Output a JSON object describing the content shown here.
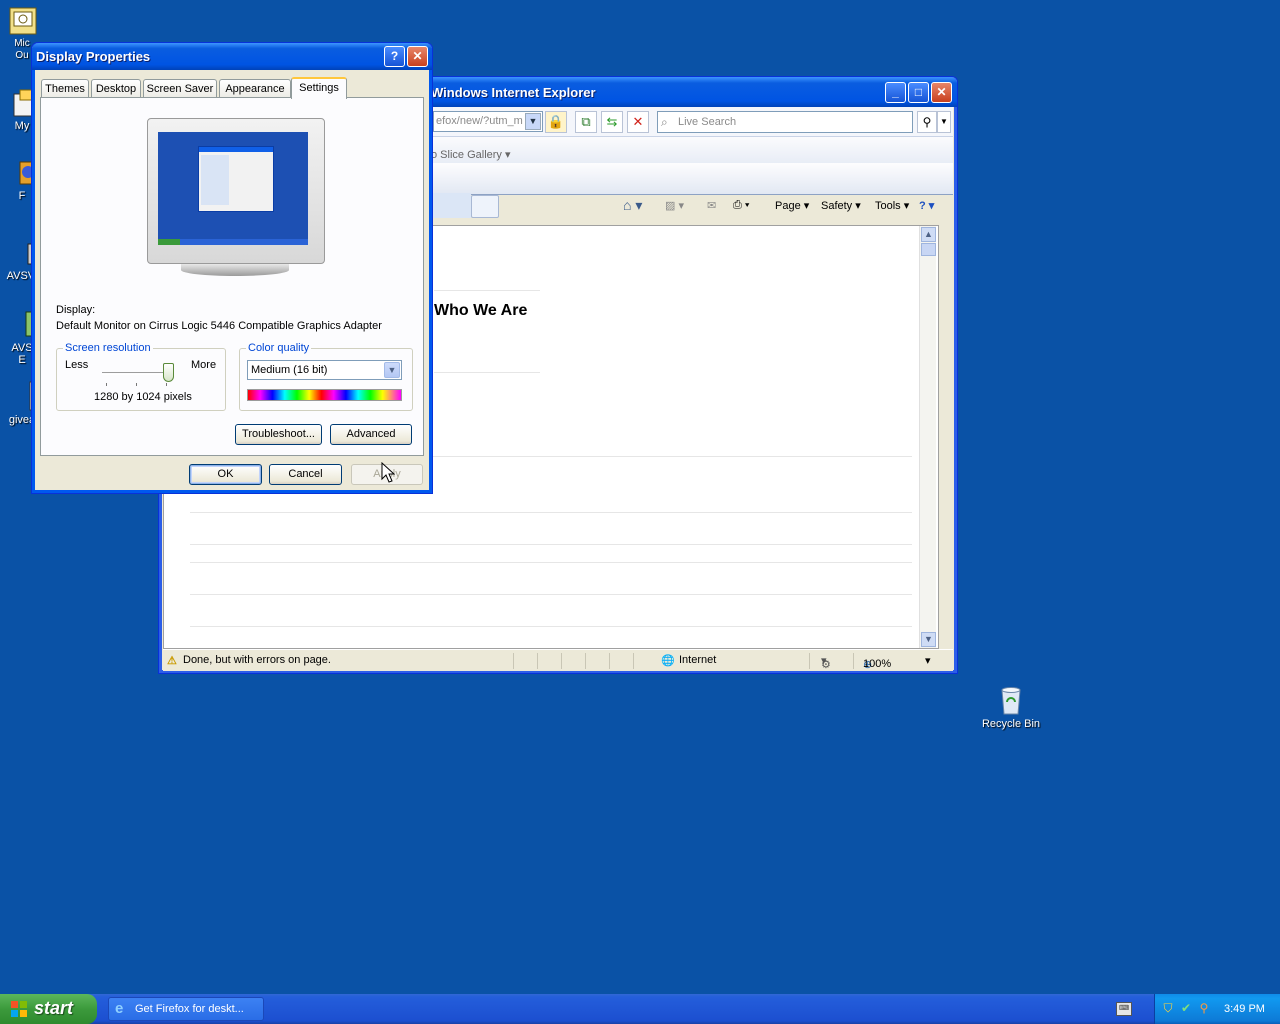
{
  "desktop": {
    "icons": [
      {
        "label": "Mic\nOu",
        "name": "outlook-desktop-icon"
      },
      {
        "label": "My",
        "name": "my-documents-desktop-icon"
      },
      {
        "label": "F",
        "name": "firefox-desktop-icon"
      },
      {
        "label": "AVSVi",
        "name": "avs-video-desktop-icon"
      },
      {
        "label": "AVS\nE",
        "name": "avs-editor-desktop-icon"
      },
      {
        "label": "givea",
        "name": "giveaway-desktop-icon"
      }
    ],
    "recycle_bin_label": "Recycle Bin"
  },
  "ie": {
    "title": "Windows Internet Explorer",
    "url_fragment": "efox/new/?utm_m",
    "search_placeholder": "Live Search",
    "favorites_item": "o Slice Gallery",
    "commands": {
      "page": "Page",
      "safety": "Safety",
      "tools": "Tools"
    },
    "page_heading": "Who We Are",
    "status_text": "Done, but with errors on page.",
    "zone": "Internet",
    "zoom": "100%"
  },
  "dialog": {
    "title": "Display Properties",
    "tabs": [
      "Themes",
      "Desktop",
      "Screen Saver",
      "Appearance",
      "Settings"
    ],
    "active_tab": "Settings",
    "display_label": "Display:",
    "display_value": "Default Monitor on Cirrus Logic 5446 Compatible Graphics Adapter",
    "resolution": {
      "legend": "Screen resolution",
      "less": "Less",
      "more": "More",
      "value_text": "1280 by 1024 pixels",
      "slider_position": 1.0
    },
    "color_quality": {
      "legend": "Color quality",
      "selected": "Medium (16 bit)"
    },
    "buttons": {
      "troubleshoot": "Troubleshoot...",
      "advanced": "Advanced",
      "ok": "OK",
      "cancel": "Cancel",
      "apply": "Apply"
    }
  },
  "taskbar": {
    "start_label": "start",
    "task_button": "Get Firefox for deskt...",
    "clock": "3:49 PM"
  },
  "colors": {
    "desktop": "#0a52a6",
    "titlebar": "#0054e3",
    "accent_group": "#0046d5",
    "active_tab_highlight": "#ffc73c"
  }
}
